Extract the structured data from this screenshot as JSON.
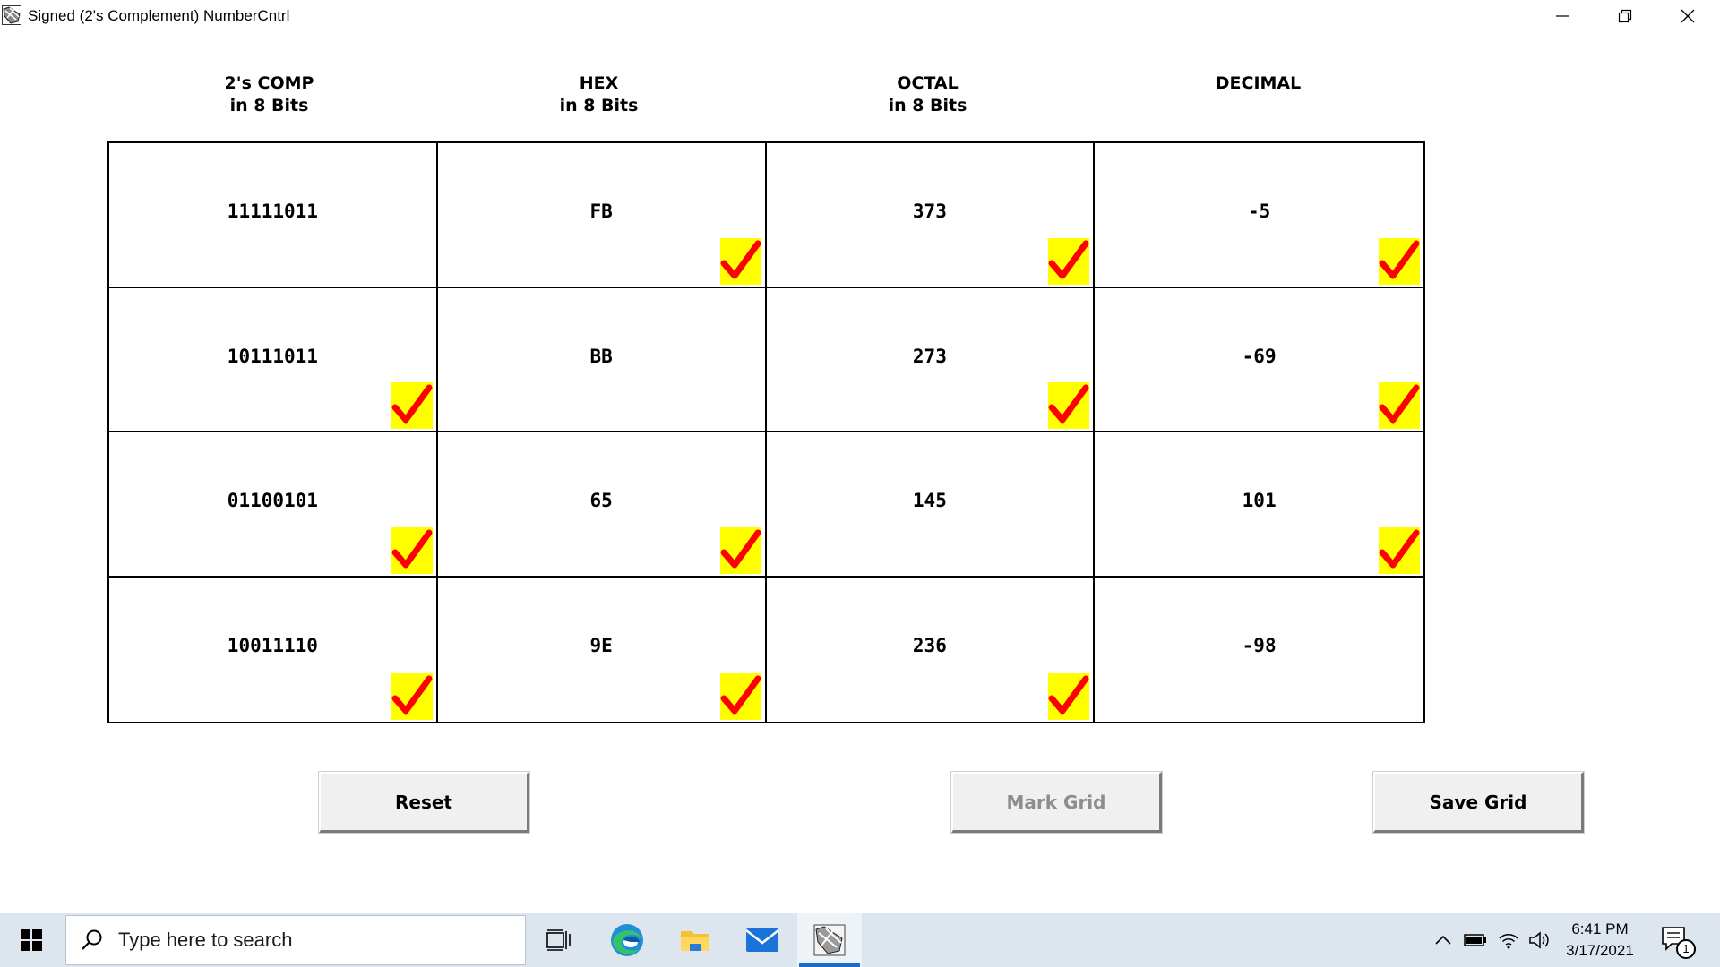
{
  "window": {
    "title": "Signed (2's Complement) NumberCntrl",
    "icon": "number-control-app-icon"
  },
  "columns": [
    {
      "line1": "2's COMP",
      "line2": "in 8 Bits"
    },
    {
      "line1": "HEX",
      "line2": "in 8 Bits"
    },
    {
      "line1": "OCTAL",
      "line2": "in 8 Bits"
    },
    {
      "line1": "DECIMAL",
      "line2": ""
    }
  ],
  "grid": {
    "check_bg_color": "#ffff00",
    "check_mark_color": "#ff0000",
    "rows": [
      {
        "cells": [
          {
            "value": "11111011",
            "checked": false
          },
          {
            "value": "FB",
            "checked": true
          },
          {
            "value": "373",
            "checked": true
          },
          {
            "value": "-5",
            "checked": true
          }
        ]
      },
      {
        "cells": [
          {
            "value": "10111011",
            "checked": true
          },
          {
            "value": "BB",
            "checked": false
          },
          {
            "value": "273",
            "checked": true
          },
          {
            "value": "-69",
            "checked": true
          }
        ]
      },
      {
        "cells": [
          {
            "value": "01100101",
            "checked": true
          },
          {
            "value": "65",
            "checked": true
          },
          {
            "value": "145",
            "checked": false
          },
          {
            "value": "101",
            "checked": true
          }
        ]
      },
      {
        "cells": [
          {
            "value": "10011110",
            "checked": true
          },
          {
            "value": "9E",
            "checked": true
          },
          {
            "value": "236",
            "checked": true
          },
          {
            "value": "-98",
            "checked": false
          }
        ]
      }
    ]
  },
  "buttons": {
    "reset": "Reset",
    "mark_grid": "Mark Grid",
    "mark_grid_enabled": false,
    "save_grid": "Save Grid"
  },
  "taskbar": {
    "search_placeholder": "Type here to search",
    "pinned": [
      "task-view-icon",
      "edge-icon",
      "file-explorer-icon",
      "mail-icon",
      "number-control-app-icon"
    ],
    "clock_time": "6:41 PM",
    "clock_date": "3/17/2021",
    "notification_count": "1",
    "accent_color": "#1b6ac9"
  }
}
